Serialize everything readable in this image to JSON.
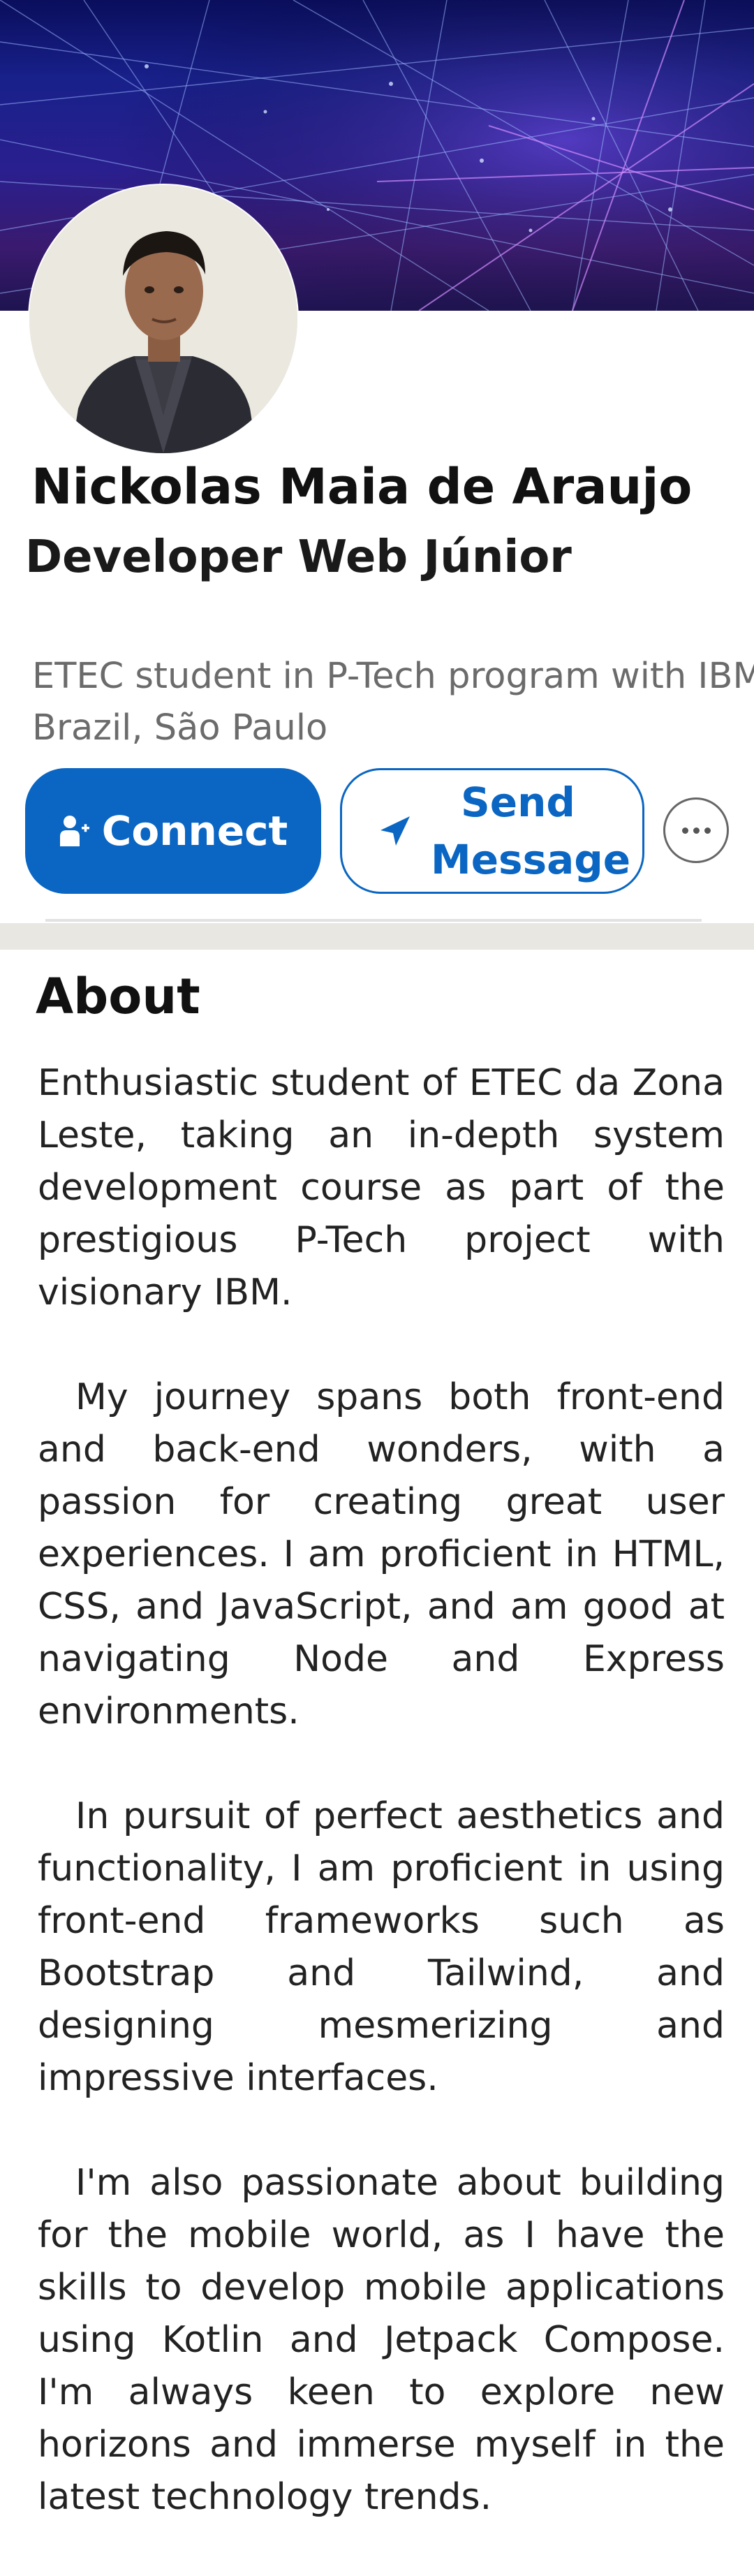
{
  "profile": {
    "name": "Nickolas Maia de Araujo",
    "headline": "Developer Web Júnior",
    "description_line1": "ETEC  student in P-Tech program with IBM",
    "location": "Brazil, São Paulo"
  },
  "actions": {
    "connect_label": "Connect",
    "message_label_line1": "Send",
    "message_label_line2": "Message"
  },
  "about": {
    "title": "About",
    "paragraphs": [
      "Enthusiastic student of ETEC da Zona Leste, taking an in-depth system development course as part of the prestigious P-Tech project with visionary IBM.",
      "My journey spans both front-end and back-end wonders, with a passion for creating great user experiences. I am proficient in HTML, CSS, and JavaScript, and am good at navigating Node and Express environments.",
      "In pursuit of perfect aesthetics and functionality, I am proficient in using front-end frameworks such as Bootstrap and Tailwind, and designing mesmerizing and impressive interfaces.",
      "I'm also passionate about building for the mobile world, as I have the skills to develop mobile applications using Kotlin and Jetpack Compose. I'm always keen to explore new horizons and immerse myself in the latest technology trends."
    ]
  },
  "colors": {
    "accent": "#0a66c2",
    "divider": "#e8e7e1",
    "banner_dark": "#0a0e5c",
    "banner_purple": "#3a1a6e"
  },
  "icons": {
    "connect": "add-person-icon",
    "message": "send-arrow-icon",
    "more": "more-horizontal-icon"
  }
}
